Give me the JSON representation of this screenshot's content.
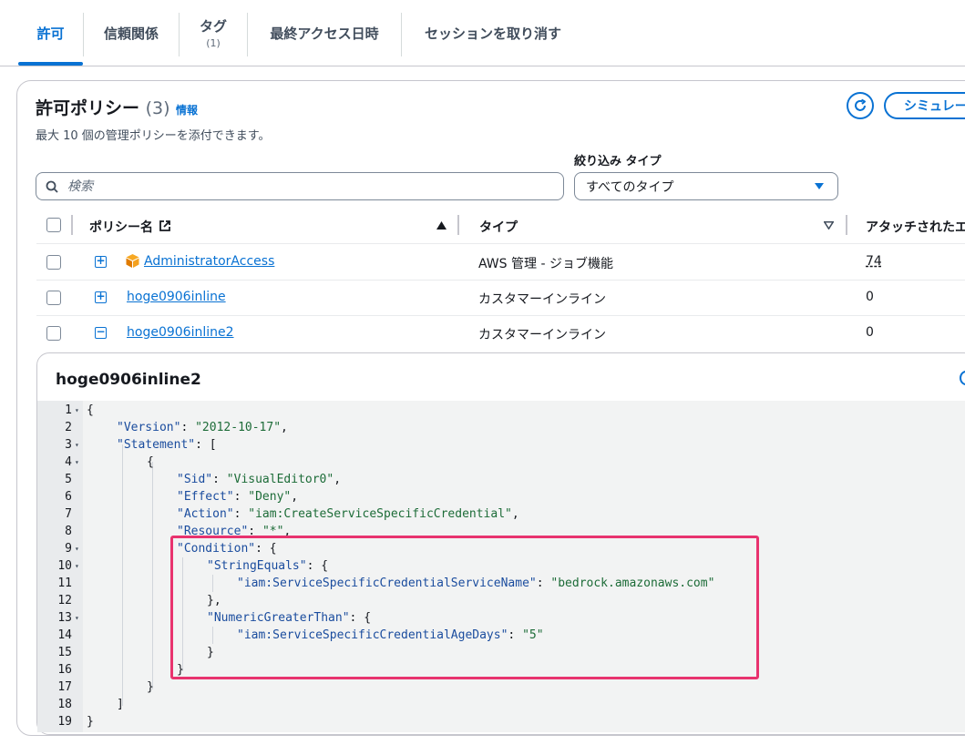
{
  "tabs": [
    {
      "label": "許可",
      "count": ""
    },
    {
      "label": "信頼関係",
      "count": ""
    },
    {
      "label": "タグ",
      "count": "(1)"
    },
    {
      "label": "最終アクセス日時",
      "count": ""
    },
    {
      "label": "セッションを取り消す",
      "count": ""
    }
  ],
  "panel": {
    "title": "許可ポリシー",
    "count": "(3)",
    "info_link": "情報",
    "subtitle": "最大 10 個の管理ポリシーを添付できます。",
    "simulate_button": "シミュレー"
  },
  "search": {
    "placeholder": "検索"
  },
  "filter": {
    "label": "絞り込み タイプ",
    "selected": "すべてのタイプ"
  },
  "table": {
    "headers": {
      "name": "ポリシー名",
      "type": "タイプ",
      "attached": "アタッチされたエ"
    },
    "rows": [
      {
        "name": "AdministratorAccess",
        "type": "AWS 管理 - ジョブ機能",
        "attached": "74",
        "expand": "+"
      },
      {
        "name": "hoge0906inline",
        "type": "カスタマーインライン",
        "attached": "0",
        "expand": "+"
      },
      {
        "name": "hoge0906inline2",
        "type": "カスタマーインライン",
        "attached": "0",
        "expand": "−"
      }
    ]
  },
  "detail": {
    "title": "hoge0906inline2",
    "lines": [
      {
        "n": "1",
        "fold": true
      },
      {
        "n": "2",
        "fold": false
      },
      {
        "n": "3",
        "fold": true
      },
      {
        "n": "4",
        "fold": true
      },
      {
        "n": "5",
        "fold": false
      },
      {
        "n": "6",
        "fold": false
      },
      {
        "n": "7",
        "fold": false
      },
      {
        "n": "8",
        "fold": false
      },
      {
        "n": "9",
        "fold": true
      },
      {
        "n": "10",
        "fold": true
      },
      {
        "n": "11",
        "fold": false
      },
      {
        "n": "12",
        "fold": false
      },
      {
        "n": "13",
        "fold": true
      },
      {
        "n": "14",
        "fold": false
      },
      {
        "n": "15",
        "fold": false
      },
      {
        "n": "16",
        "fold": false
      },
      {
        "n": "17",
        "fold": false
      },
      {
        "n": "18",
        "fold": false
      },
      {
        "n": "19",
        "fold": false
      }
    ],
    "code": {
      "open_brace": "{",
      "version_key": "\"Version\"",
      "version_val": "\"2012-10-17\"",
      "statement_key": "\"Statement\"",
      "statement_open": ": [",
      "obj_open": "{",
      "sid_key": "\"Sid\"",
      "sid_val": "\"VisualEditor0\"",
      "effect_key": "\"Effect\"",
      "effect_val": "\"Deny\"",
      "action_key": "\"Action\"",
      "action_val": "\"iam:CreateServiceSpecificCredential\"",
      "resource_key": "\"Resource\"",
      "resource_val": "\"*\"",
      "condition_key": "\"Condition\"",
      "stringequals_key": "\"StringEquals\"",
      "svcname_key": "\"iam:ServiceSpecificCredentialServiceName\"",
      "svcname_val": "\"bedrock.amazonaws.com\"",
      "close_brace_comma": "},",
      "numeric_key": "\"NumericGreaterThan\"",
      "agedays_key": "\"iam:ServiceSpecificCredentialAgeDays\"",
      "agedays_val": "\"5\"",
      "close_brace": "}",
      "close_bracket": "]"
    }
  },
  "colors": {
    "accent": "#0972d3",
    "highlight": "#e8336e",
    "string": "#1d6c38",
    "key": "#1a4c9e"
  }
}
